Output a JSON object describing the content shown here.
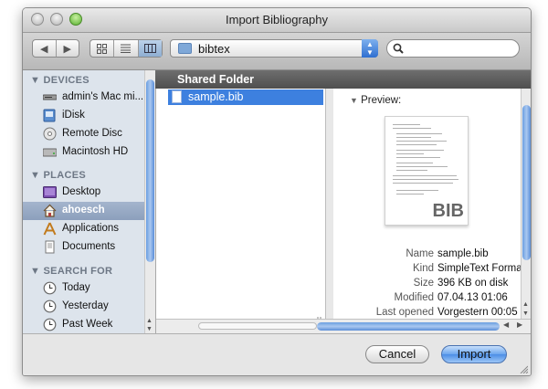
{
  "window": {
    "title": "Import Bibliography"
  },
  "toolbar": {
    "back": "◀",
    "forward": "▶",
    "location": "bibtex",
    "search_placeholder": ""
  },
  "sidebar": {
    "sections": [
      {
        "header": "DEVICES",
        "items": [
          {
            "label": "admin's Mac mi...",
            "icon": "computer-icon"
          },
          {
            "label": "iDisk",
            "icon": "idisk-icon"
          },
          {
            "label": "Remote Disc",
            "icon": "disc-icon"
          },
          {
            "label": "Macintosh HD",
            "icon": "harddisk-icon"
          }
        ]
      },
      {
        "header": "PLACES",
        "items": [
          {
            "label": "Desktop",
            "icon": "desktop-icon"
          },
          {
            "label": "ahoesch",
            "icon": "home-icon",
            "selected": true
          },
          {
            "label": "Applications",
            "icon": "applications-icon"
          },
          {
            "label": "Documents",
            "icon": "documents-icon"
          }
        ]
      },
      {
        "header": "SEARCH FOR",
        "items": [
          {
            "label": "Today",
            "icon": "clock-icon"
          },
          {
            "label": "Yesterday",
            "icon": "clock-icon"
          },
          {
            "label": "Past Week",
            "icon": "clock-icon"
          }
        ]
      }
    ]
  },
  "browser": {
    "header": "Shared Folder",
    "files": [
      {
        "name": "sample.bib",
        "selected": true
      }
    ]
  },
  "preview": {
    "label": "Preview:",
    "thumb_ext": "BIB",
    "info": [
      {
        "key": "Name",
        "value": "sample.bib"
      },
      {
        "key": "Kind",
        "value": "SimpleText Format"
      },
      {
        "key": "Size",
        "value": "396 KB on disk"
      },
      {
        "key": "Modified",
        "value": "07.04.13 01:06"
      },
      {
        "key": "Last opened",
        "value": "Vorgestern 00:05"
      }
    ]
  },
  "buttons": {
    "cancel": "Cancel",
    "import": "Import"
  },
  "colors": {
    "selection": "#3d80df",
    "sidebar_bg": "#dde4ec",
    "accent_button": "#4c8ee6"
  }
}
